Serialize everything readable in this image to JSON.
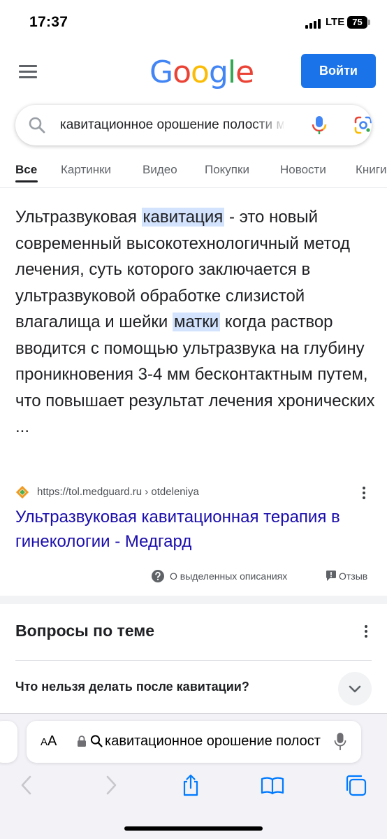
{
  "status_bar": {
    "time": "17:37",
    "network": "LTE",
    "battery": "75"
  },
  "header": {
    "logo": {
      "letters": [
        "G",
        "o",
        "o",
        "g",
        "l",
        "e"
      ],
      "colors": [
        "#4285f4",
        "#ea4335",
        "#fbbc05",
        "#4285f4",
        "#34a853",
        "#ea4335"
      ]
    },
    "signin_label": "Войти",
    "menu_icon": "hamburger-menu-icon"
  },
  "search": {
    "query": "кавитационное орошение полости матки"
  },
  "tabs": [
    {
      "label": "Все",
      "active": true
    },
    {
      "label": "Картинки",
      "active": false
    },
    {
      "label": "Видео",
      "active": false
    },
    {
      "label": "Покупки",
      "active": false
    },
    {
      "label": "Новости",
      "active": false
    },
    {
      "label": "Книги",
      "active": false
    }
  ],
  "snippet": {
    "part1": "Ультразвуковая ",
    "highlight1": "кавитация",
    "part2": " - это новый современный высокотехнологичный метод лечения, суть которого заключается в ультразвуковой обработке слизистой влагалища и шейки ",
    "highlight2": "матки",
    "part3": " когда раствор вводится с помощью ультразвука на глубину проникновения 3-4 мм бесконтактным путем, что повышает результат лечения хронических ..."
  },
  "result": {
    "url": "https://tol.medguard.ru › otdeleniya",
    "title": "Ультразвуковая кавитационная терапия в гинекологии - Медгард"
  },
  "feedback": {
    "about_label": "О выделенных описаниях",
    "feedback_label": "Отзыв"
  },
  "paa": {
    "title": "Вопросы по теме",
    "questions": [
      "Что нельзя делать после кавитации?"
    ]
  },
  "safari": {
    "aa_label_small": "A",
    "aa_label_large": "A",
    "address_text": "кавитационное орошение полости матки",
    "accent": "#007aff"
  },
  "colors": {
    "link": "#1a0dab",
    "highlight": "#d3e3fd",
    "signin_button": "#1a73e8"
  }
}
